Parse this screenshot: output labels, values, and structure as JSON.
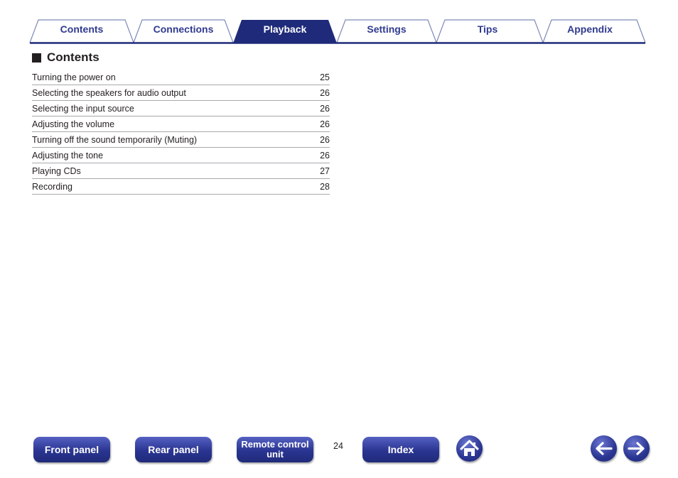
{
  "tabs": [
    {
      "label": "Contents",
      "active": false
    },
    {
      "label": "Connections",
      "active": false
    },
    {
      "label": "Playback",
      "active": true
    },
    {
      "label": "Settings",
      "active": false
    },
    {
      "label": "Tips",
      "active": false
    },
    {
      "label": "Appendix",
      "active": false
    }
  ],
  "section": {
    "title": "Contents"
  },
  "toc": [
    {
      "label": "Turning the power on",
      "page": "25"
    },
    {
      "label": "Selecting the speakers for audio output",
      "page": "26"
    },
    {
      "label": "Selecting the input source",
      "page": "26"
    },
    {
      "label": "Adjusting the volume",
      "page": "26"
    },
    {
      "label": "Turning off the sound temporarily (Muting)",
      "page": "26"
    },
    {
      "label": "Adjusting the tone",
      "page": "26"
    },
    {
      "label": "Playing CDs",
      "page": "27"
    },
    {
      "label": "Recording",
      "page": "28"
    }
  ],
  "nav": {
    "front_panel": "Front panel",
    "rear_panel": "Rear panel",
    "remote_line1": "Remote control",
    "remote_line2": "unit",
    "page_number": "24",
    "index": "Index",
    "home_icon": "home-icon",
    "back_icon": "arrow-left-icon",
    "forward_icon": "arrow-right-icon"
  },
  "colors": {
    "tab_text": "#2f3a8f",
    "active_tab": "#1f2a7a",
    "button": "#2a3591",
    "rule": "#a7a9ac"
  }
}
